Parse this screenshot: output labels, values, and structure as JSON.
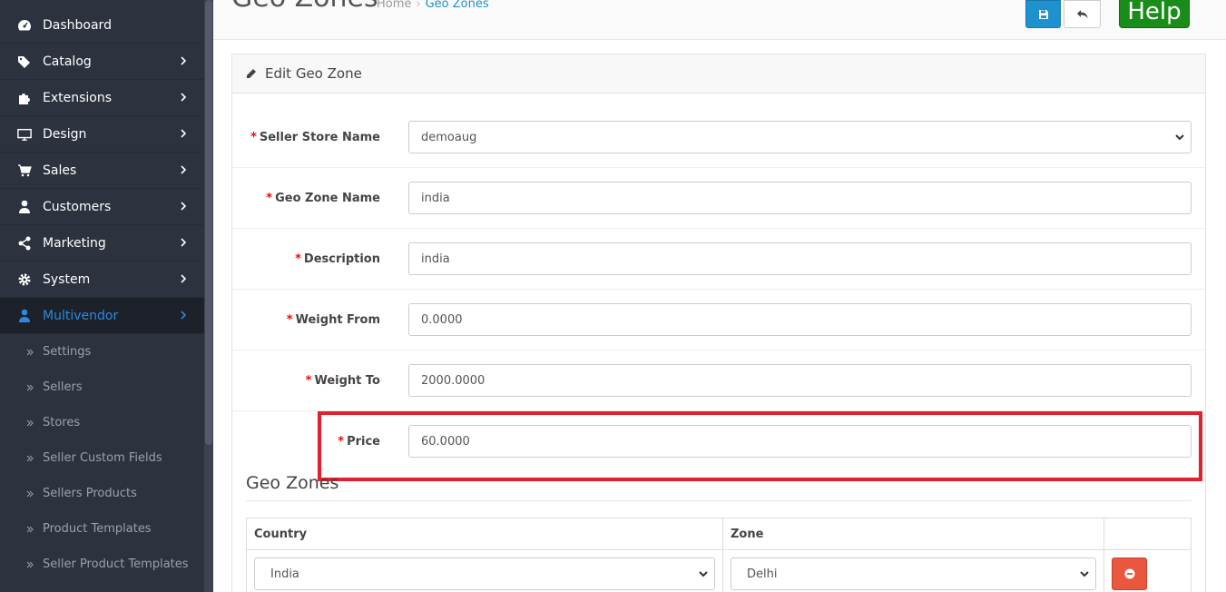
{
  "sidebar": {
    "items": [
      {
        "label": "Dashboard",
        "icon": "dashboard-icon",
        "has_children": false
      },
      {
        "label": "Catalog",
        "icon": "tags-icon",
        "has_children": true
      },
      {
        "label": "Extensions",
        "icon": "puzzle-icon",
        "has_children": true
      },
      {
        "label": "Design",
        "icon": "monitor-icon",
        "has_children": true
      },
      {
        "label": "Sales",
        "icon": "cart-icon",
        "has_children": true
      },
      {
        "label": "Customers",
        "icon": "user-icon",
        "has_children": true
      },
      {
        "label": "Marketing",
        "icon": "share-icon",
        "has_children": true
      },
      {
        "label": "System",
        "icon": "gear-icon",
        "has_children": true
      },
      {
        "label": "Multivendor",
        "icon": "user-icon",
        "has_children": true,
        "active": true
      }
    ],
    "sub_items": [
      {
        "label": "Settings"
      },
      {
        "label": "Sellers"
      },
      {
        "label": "Stores"
      },
      {
        "label": "Seller Custom Fields"
      },
      {
        "label": "Sellers Products"
      },
      {
        "label": "Product Templates"
      },
      {
        "label": "Seller Product Templates"
      }
    ]
  },
  "header": {
    "title": "Geo Zones",
    "breadcrumb": [
      {
        "label": "Home"
      },
      {
        "label": "Geo Zones"
      }
    ],
    "breadcrumb_sep": "›",
    "help_label": "Help"
  },
  "panel": {
    "title": "Edit Geo Zone",
    "required_marker": "*",
    "fields": [
      {
        "label": "Seller Store Name",
        "value": "demoaug",
        "type": "select"
      },
      {
        "label": "Geo Zone Name",
        "value": "india",
        "type": "text"
      },
      {
        "label": "Description",
        "value": "india",
        "type": "text"
      },
      {
        "label": "Weight From",
        "value": "0.0000",
        "type": "text"
      },
      {
        "label": "Weight To",
        "value": "2000.0000",
        "type": "text"
      },
      {
        "label": "Price",
        "value": "60.0000",
        "type": "text"
      }
    ]
  },
  "geo_zones": {
    "title": "Geo Zones",
    "columns": [
      "Country",
      "Zone",
      ""
    ],
    "rows": [
      {
        "country": "India",
        "zone": "Delhi"
      }
    ]
  },
  "colors": {
    "sidebar_bg": "#2d323f",
    "active_accent": "#2b8ae0",
    "primary": "#1e91cf",
    "help": "#1a8c1a",
    "danger": "#e9573f",
    "highlight": "#e0202a"
  }
}
